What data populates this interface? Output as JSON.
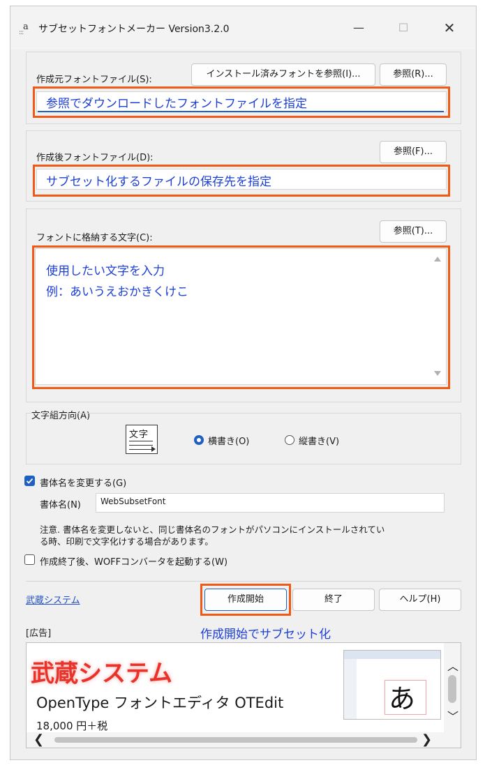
{
  "window": {
    "title": "サブセットフォントメーカー Version3.2.0",
    "minimize_glyph": "—",
    "maximize_glyph": "☐",
    "close_glyph": "✕"
  },
  "source": {
    "label": "作成元フォントファイル(S):",
    "installed_button": "インストール済みフォントを参照(I)...",
    "browse_button": "参照(R)...",
    "field_value": "",
    "annotation": "参照でダウンロードしたフォントファイルを指定"
  },
  "dest": {
    "label": "作成後フォントファイル(D):",
    "browse_button": "参照(F)...",
    "field_value": "",
    "annotation": "サブセット化するファイルの保存先を指定"
  },
  "chars": {
    "label": "フォントに格納する文字(C):",
    "browse_button": "参照(T)...",
    "annotation_line1": "使用したい文字を入力",
    "annotation_line2": "例：あいうえおかきくけこ"
  },
  "direction": {
    "label": "文字組方向(A)",
    "icon_text": "文字",
    "horizontal": "横書き(O)",
    "vertical": "縦書き(V)",
    "selected": "horizontal"
  },
  "rename": {
    "checkbox_label": "書体名を変更する(G)",
    "checked": true,
    "name_label": "書体名(N)",
    "name_value": "WebSubsetFont",
    "note_line1": "注意. 書体名を変更しないと、同じ書体名のフォントがパソコンにインストールされてい",
    "note_line2": "る時、印刷で文字化けする場合があります。"
  },
  "woff": {
    "checkbox_label": "作成終了後、WOFFコンバータを起動する(W)",
    "checked": false
  },
  "footer": {
    "link": "武蔵システム",
    "start_button": "作成開始",
    "exit_button": "終了",
    "help_button": "ヘルプ(H)",
    "annotation": "作成開始でサブセット化"
  },
  "ad": {
    "label": "[広告]",
    "brand": "武蔵システム",
    "product": "OpenType フォントエディタ  OTEdit",
    "price": "18,000 円＋税",
    "thumb_glyph": "あ",
    "brand_color": "#e8322a"
  },
  "colors": {
    "highlight_border": "#f05a16",
    "annotation_text": "#1c3fd6",
    "accent": "#1f5fbf"
  }
}
